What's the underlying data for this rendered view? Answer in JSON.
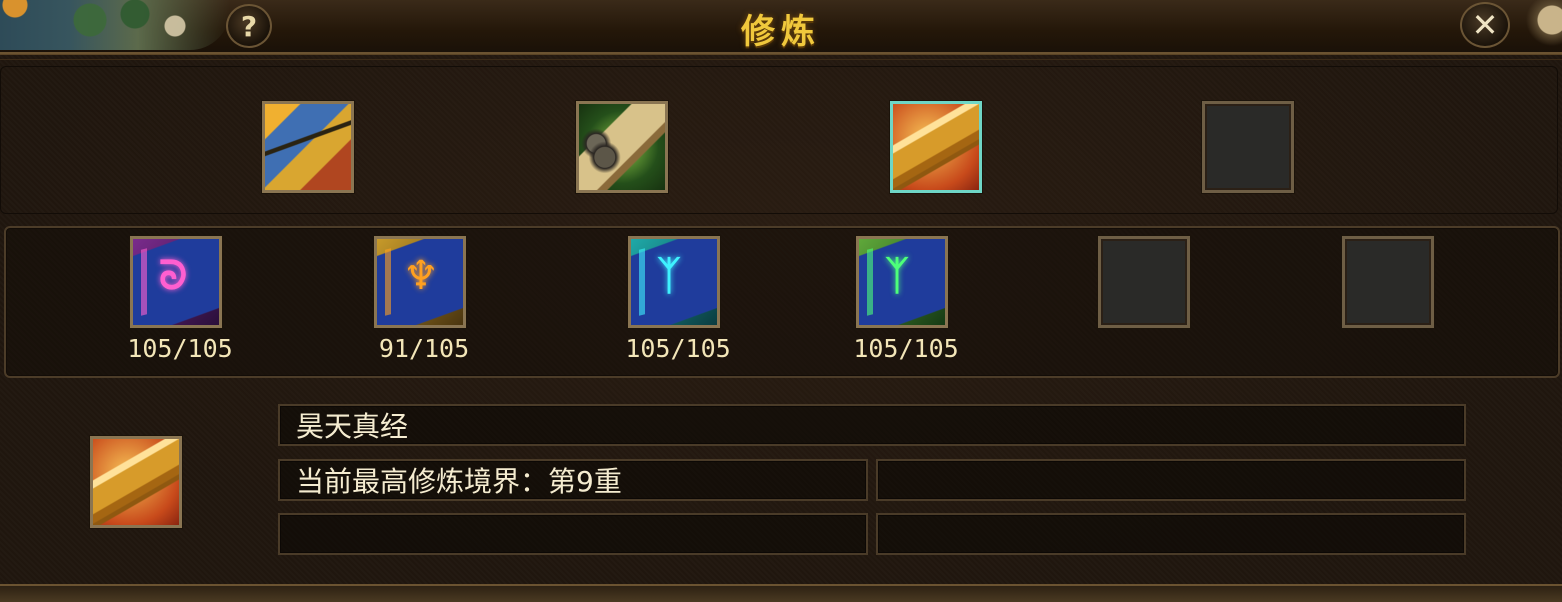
{
  "title": "修炼",
  "help_label": "?",
  "close_label": "✕",
  "top_slots": [
    {
      "icon": "golden-book-icon",
      "empty": false
    },
    {
      "icon": "bamboo-scroll-bundle-icon",
      "empty": false
    },
    {
      "icon": "gold-ingot-book-icon",
      "empty": false,
      "selected": true
    },
    {
      "icon": "empty-slot",
      "empty": true
    }
  ],
  "mid_slots": [
    {
      "icon": "pink-meridian-card-icon",
      "count": "105/105",
      "glyph": "ᘐ"
    },
    {
      "icon": "orange-meridian-card-icon",
      "count": "91/105",
      "glyph": "♆"
    },
    {
      "icon": "cyan-meridian-card-icon",
      "count": "105/105",
      "glyph": "ᛉ"
    },
    {
      "icon": "green-meridian-card-icon",
      "count": "105/105",
      "glyph": "ᛉ"
    },
    {
      "icon": "empty-slot",
      "count": ""
    },
    {
      "icon": "empty-slot",
      "count": ""
    }
  ],
  "info": {
    "name": "昊天真经",
    "realm": "当前最高修炼境界：第9重",
    "row2_right": "",
    "row3_left": "",
    "row3_right": ""
  },
  "colors": {
    "title": "#f0c83c",
    "text": "#f5ecd0",
    "border": "#8a7552",
    "selected_border": "#6fd6c6"
  }
}
